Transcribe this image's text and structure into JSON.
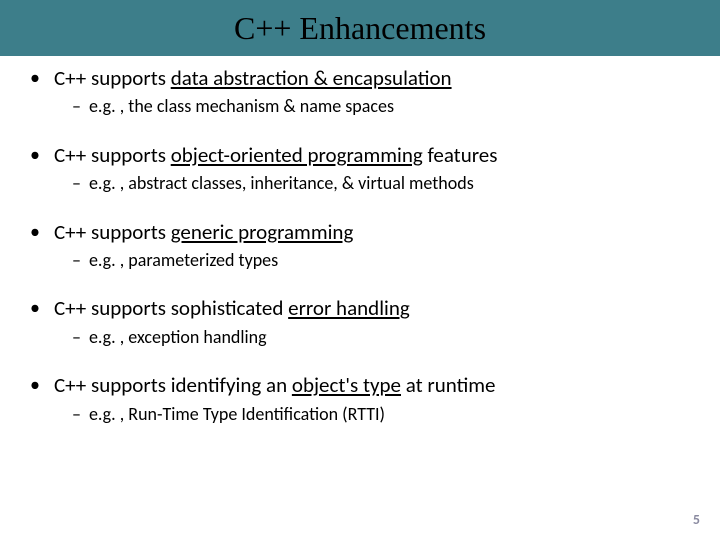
{
  "header": {
    "title": "C++ Enhancements"
  },
  "bullets": [
    {
      "pre": "C++ supports ",
      "mid": "data abstraction & encapsulation",
      "post": "",
      "sub": "e.g. , the class mechanism & name spaces"
    },
    {
      "pre": "C++ supports ",
      "mid": "object-oriented programming",
      "post": " features",
      "sub": "e.g. , abstract classes, inheritance, & virtual methods"
    },
    {
      "pre": "C++ supports ",
      "mid": "generic programming",
      "post": "",
      "sub": "e.g. , parameterized types"
    },
    {
      "pre": "C++ supports sophisticated ",
      "mid": "error handling",
      "post": "",
      "sub": "e.g. , exception handling"
    },
    {
      "pre": "C++ supports identifying an ",
      "mid": "object's type",
      "post": " at runtime",
      "sub": "e.g. , Run-Time Type Identification (RTTI)"
    }
  ],
  "pageNumber": "5"
}
